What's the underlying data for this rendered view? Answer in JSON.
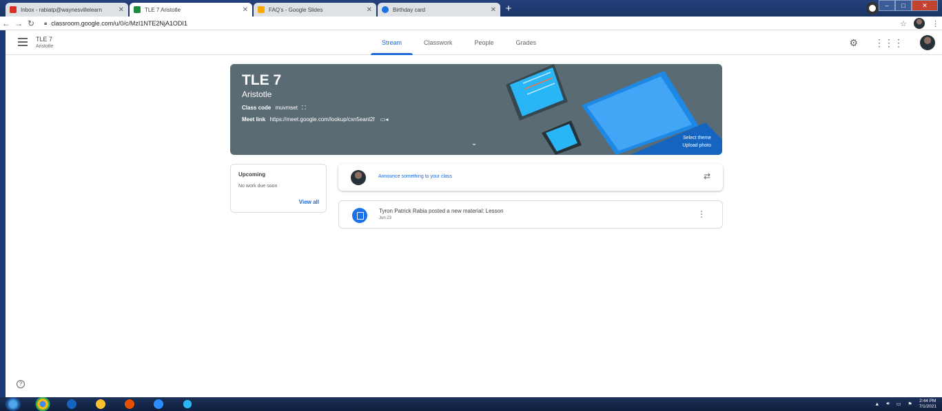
{
  "browser": {
    "tabs": [
      {
        "title": "Inbox - rabiatp@waynesvillelearn",
        "icon_color": "#d93025",
        "active": false
      },
      {
        "title": "TLE 7 Aristotle",
        "icon_color": "#1e8e3e",
        "active": true
      },
      {
        "title": "FAQ's - Google Slides",
        "icon_color": "#f9ab00",
        "active": false
      },
      {
        "title": "Birthday card",
        "icon_color": "#1a73e8",
        "active": false
      }
    ],
    "new_tab": "+",
    "url": "classroom.google.com/u/0/c/MzI1NTE2NjA1ODI1"
  },
  "header": {
    "class_name": "TLE 7",
    "section": "Aristotle",
    "tabs": [
      "Stream",
      "Classwork",
      "People",
      "Grades"
    ],
    "active_tab": "Stream"
  },
  "banner": {
    "title": "TLE 7",
    "subtitle": "Aristotle",
    "class_code_label": "Class code",
    "class_code": "muvmset",
    "meet_label": "Meet link",
    "meet_url": "https://meet.google.com/lookup/cxn5eanl2f",
    "select_theme": "Select theme",
    "upload_photo": "Upload photo",
    "color": "#5a6b74"
  },
  "upcoming": {
    "title": "Upcoming",
    "empty_text": "No work due soon",
    "view_all": "View all"
  },
  "announce": {
    "placeholder": "Announce something to your class"
  },
  "posts": [
    {
      "title": "Tyron Patrick Rabia posted a new material: Lesson",
      "date": "Jun 23"
    }
  ],
  "taskbar": {
    "time": "2:44 PM",
    "date": "7/1/2021"
  }
}
